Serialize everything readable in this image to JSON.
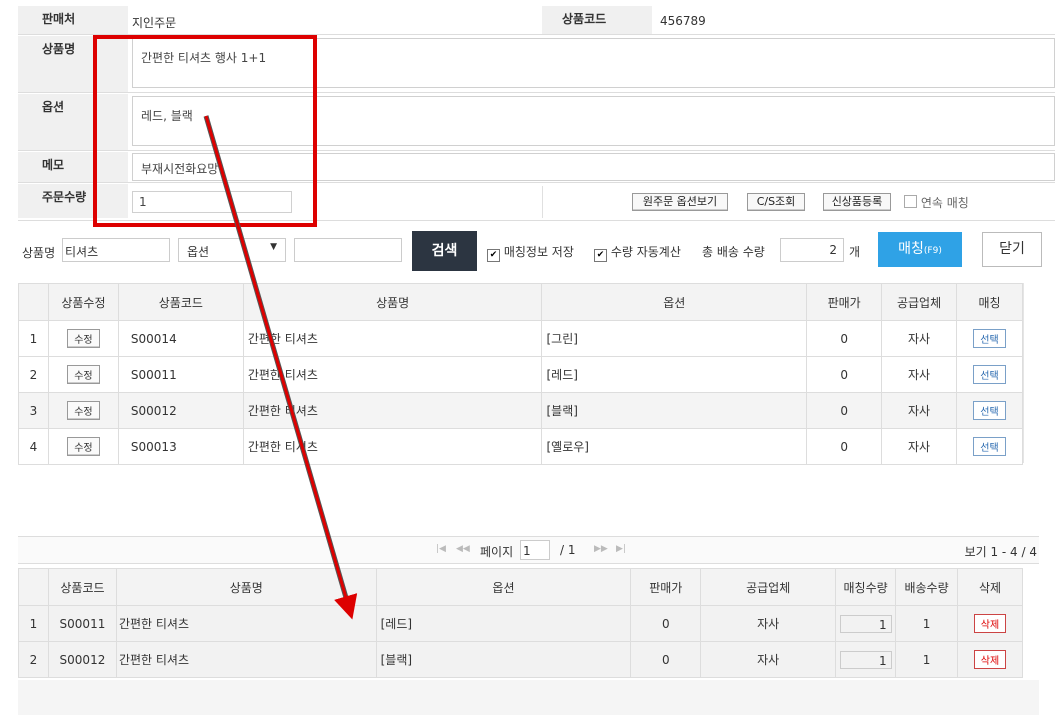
{
  "form": {
    "seller_label": "판매처",
    "seller_value": "지인주문",
    "product_code_label": "상품코드",
    "product_code_value": "456789",
    "product_name_label": "상품명",
    "product_name_value": "간편한 티셔츠 행사 1+1",
    "option_label": "옵션",
    "option_value": "레드, 블랙",
    "memo_label": "메모",
    "memo_value": "부재시전화요망",
    "qty_label": "주문수량",
    "qty_value": "1",
    "btn_view_options": "원주문 옵션보기",
    "btn_cs": "C/S조회",
    "btn_new_product": "신상품등록",
    "continuous_label": "연속 매칭"
  },
  "search": {
    "name_label": "상품명",
    "name_value": "티셔츠",
    "option_select": "옵션",
    "option_input": "",
    "search_btn": "검색",
    "save_match_label": "매칭정보 저장",
    "auto_qty_label": "수량 자동계산",
    "total_ship_label": "총 배송 수량",
    "total_ship_value": "2",
    "unit": "개",
    "match_btn": "매칭",
    "match_key": "(F9)",
    "close_btn": "닫기"
  },
  "grid1": {
    "headers": [
      "",
      "상품수정",
      "상품코드",
      "상품명",
      "옵션",
      "판매가",
      "공급업체",
      "매칭"
    ],
    "edit_label": "수정",
    "select_label": "선택",
    "rows": [
      {
        "no": "1",
        "code": "S00014",
        "name": "간편한 티셔츠",
        "option": "[그린]",
        "price": "0",
        "vendor": "자사"
      },
      {
        "no": "2",
        "code": "S00011",
        "name": "간편한 티셔츠",
        "option": "[레드]",
        "price": "0",
        "vendor": "자사"
      },
      {
        "no": "3",
        "code": "S00012",
        "name": "간편한 티셔츠",
        "option": "[블랙]",
        "price": "0",
        "vendor": "자사"
      },
      {
        "no": "4",
        "code": "S00013",
        "name": "간편한 티셔츠",
        "option": "[옐로우]",
        "price": "0",
        "vendor": "자사"
      }
    ]
  },
  "pager": {
    "page_label": "페이지",
    "page_value": "1",
    "of_total": "/ 1",
    "view_info": "보기 1 - 4 / 4"
  },
  "grid2": {
    "headers": [
      "",
      "상품코드",
      "상품명",
      "옵션",
      "판매가",
      "공급업체",
      "매칭수량",
      "배송수량",
      "삭제"
    ],
    "delete_label": "삭제",
    "rows": [
      {
        "no": "1",
        "code": "S00011",
        "name": "간편한 티셔츠",
        "option": "[레드]",
        "price": "0",
        "vendor": "자사",
        "match_qty": "1",
        "ship_qty": "1"
      },
      {
        "no": "2",
        "code": "S00012",
        "name": "간편한 티셔츠",
        "option": "[블랙]",
        "price": "0",
        "vendor": "자사",
        "match_qty": "1",
        "ship_qty": "1"
      }
    ]
  },
  "colors": {
    "annotation_red": "#dd0000",
    "match_button_blue": "#2fa2e6",
    "search_button_dark": "#2c3541"
  }
}
